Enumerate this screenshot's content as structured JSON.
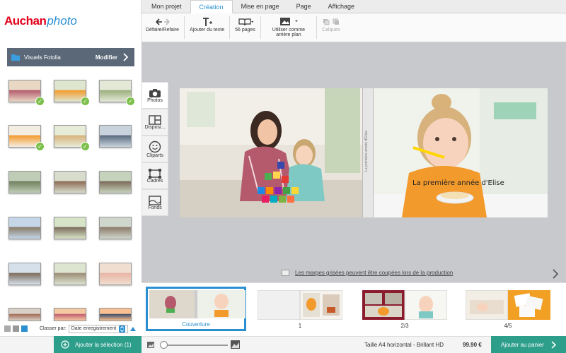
{
  "logo": {
    "brand": "Auchan",
    "product": "photo"
  },
  "tabs": [
    "Mon projet",
    "Création",
    "Mise en page",
    "Page",
    "Affichage"
  ],
  "active_tab": "Création",
  "toolbar": {
    "undo_label": "Défaire/Refaire",
    "addtext_label": "Ajouter du texte",
    "pages_label": "56 pages",
    "background_label": "Utiliser comme arrière plan",
    "layers_label": "Calques"
  },
  "folder": {
    "name": "Visuels Fotolia",
    "action": "Modifier"
  },
  "side_tools": [
    "Photos",
    "Disposi...",
    "Cliparts",
    "Cadres",
    "Fonds"
  ],
  "sort": {
    "label": "Classer par:",
    "value": "Date enregistrement"
  },
  "canvas": {
    "cover_text": "La première année d'Elise",
    "spine_text": "La première année d'Elise",
    "margin_note": "Les marges grisées peuvent être coupées lors de la production"
  },
  "pages": [
    {
      "label": "Couverture",
      "selected": true
    },
    {
      "label": "1",
      "selected": false
    },
    {
      "label": "2/3",
      "selected": false
    },
    {
      "label": "4/5",
      "selected": false
    }
  ],
  "footer": {
    "add_selection": "Ajouter la sélection (1)",
    "format": "Taille A4 horizontal - Brillant HD",
    "price": "99.90 €",
    "add_cart": "Ajouter au panier"
  },
  "colors": {
    "accent": "#2a8fd0",
    "cta": "#2c9e8a",
    "brand": "#e2001a",
    "check": "#7cc04b"
  }
}
